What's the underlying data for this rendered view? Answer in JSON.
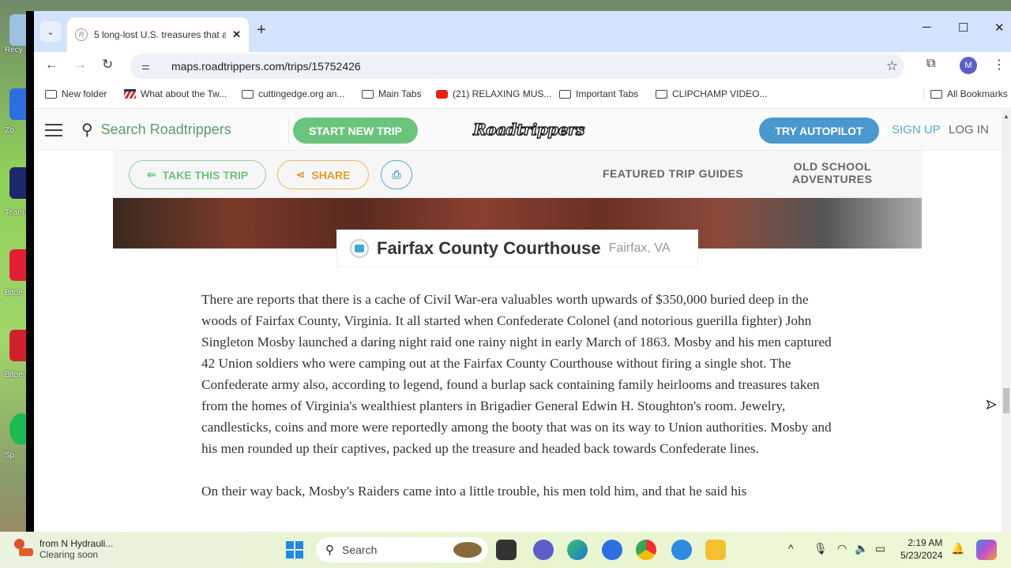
{
  "desktop": {
    "icons": [
      {
        "label": "Recy",
        "color": "#9cc0e0"
      },
      {
        "label": "Zo",
        "color": "#2d6fe0"
      },
      {
        "label": "Team H",
        "color": "#1a2a6a"
      },
      {
        "label": "Bitde",
        "color": "#e02030"
      },
      {
        "label": "Bitde V",
        "color": "#d02030"
      },
      {
        "label": "Sp",
        "color": "#1db954"
      }
    ]
  },
  "browser": {
    "tab": {
      "title": "5 long-lost U.S. treasures that a",
      "close": "✕"
    },
    "new_tab": "+",
    "window_controls": {
      "minimize": "─",
      "maximize": "☐",
      "close": "✕"
    },
    "nav": {
      "back": "←",
      "forward": "→",
      "reload": "↻"
    },
    "url": "maps.roadtrippers.com/trips/15752426",
    "star": "☆",
    "extensions": "⧉",
    "profile_initial": "M",
    "menu": "⋮",
    "bookmarks": [
      {
        "label": "New folder",
        "icon": "folder"
      },
      {
        "label": "What about the Tw...",
        "icon": "flag"
      },
      {
        "label": "cuttingedge.org an...",
        "icon": "folder"
      },
      {
        "label": "Main Tabs",
        "icon": "folder"
      },
      {
        "label": "(21) RELAXING MUS...",
        "icon": "youtube"
      },
      {
        "label": "Important Tabs",
        "icon": "folder"
      },
      {
        "label": "CLIPCHAMP VIDEO...",
        "icon": "folder"
      }
    ],
    "all_bookmarks": "All Bookmarks"
  },
  "site": {
    "search_label": "Search Roadtrippers",
    "start_trip": "START NEW TRIP",
    "logo": "Roadtrippers",
    "autopilot": "TRY AUTOPILOT",
    "sign_up": "SIGN UP",
    "log_in": "LOG IN",
    "take_trip": "TAKE THIS TRIP",
    "share": "SHARE",
    "featured": "FEATURED TRIP GUIDES",
    "old_school_1": "OLD SCHOOL",
    "old_school_2": "ADVENTURES",
    "caption_name": "Fairfax County Courthouse",
    "caption_location": "Fairfax, VA",
    "paragraphs": [
      "There are reports that there is a cache of Civil War-era valuables worth upwards of $350,000 buried deep in the woods of Fairfax County, Virginia. It all started when Confederate Colonel (and notorious guerilla fighter) John Singleton Mosby launched a daring night raid one rainy night in early March of 1863. Mosby and his men captured 42 Union soldiers who were camping out at the Fairfax County Courthouse without firing a single shot. The Confederate army also, according to legend, found a burlap sack containing family heirlooms and treasures taken from the homes of Virginia's wealthiest planters in Brigadier General Edwin H. Stoughton's room. Jewelry, candlesticks, coins and more were reportedly among the booty that was on its way to Union authorities. Mosby and his men rounded up their captives, packed up the treasure and headed back towards Confederate lines.",
      "On their way back, Mosby's Raiders came into a little trouble, his men told him, and that he said his"
    ]
  },
  "taskbar": {
    "weather_title": "from N Hydrauli...",
    "weather_sub": "Clearing soon",
    "search": "Search",
    "tray_up": "^",
    "time": "2:19 AM",
    "date": "5/23/2024"
  }
}
